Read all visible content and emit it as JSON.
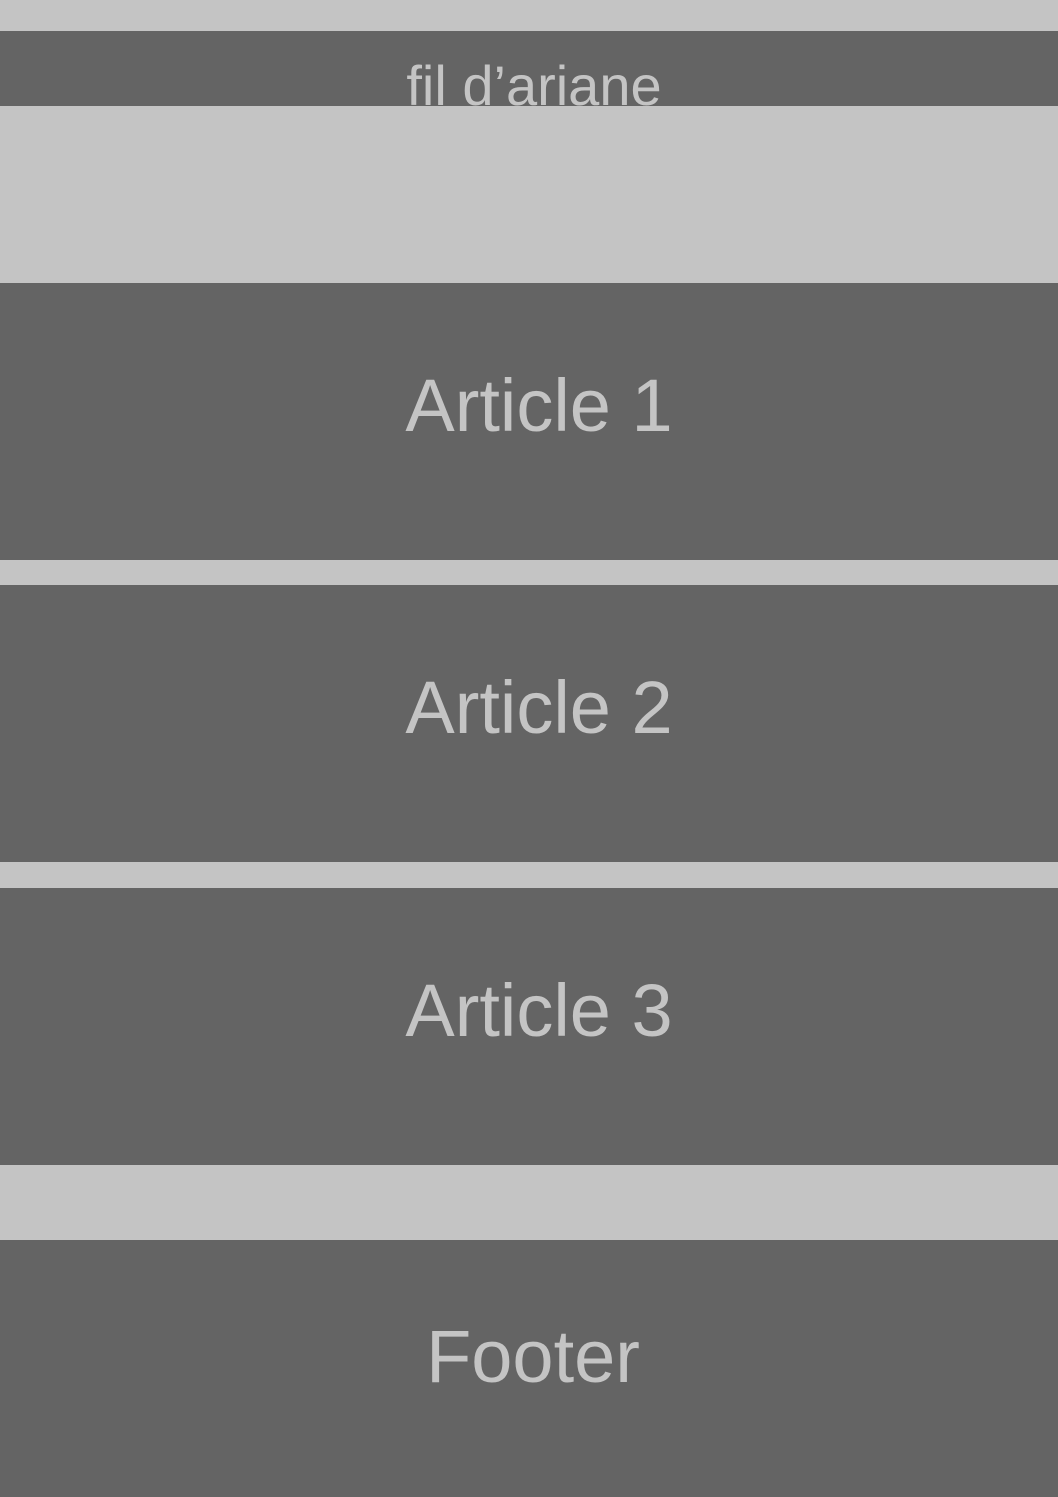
{
  "breadcrumb": {
    "label": "fil d’ariane"
  },
  "articles": [
    {
      "label": "Article 1"
    },
    {
      "label": "Article 2"
    },
    {
      "label": "Article 3"
    }
  ],
  "footer": {
    "label": "Footer"
  },
  "colors": {
    "background": "#c4c4c4",
    "block": "#646464",
    "text": "#c4c4c4"
  }
}
